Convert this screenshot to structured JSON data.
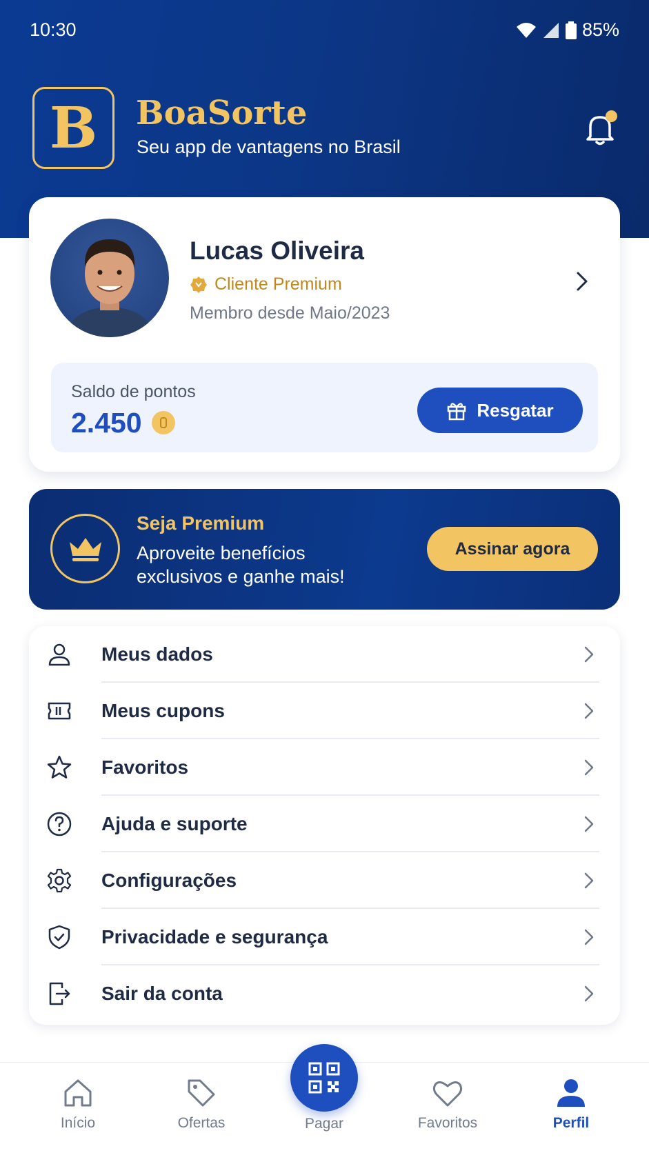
{
  "status_bar": {
    "time": "10:30",
    "battery": "85%"
  },
  "brand": {
    "logo_letter": "B",
    "name": "BoaSorte",
    "tagline": "Seu app de vantagens no Brasil"
  },
  "profile": {
    "name": "Lucas Oliveira",
    "tier": "Cliente Premium",
    "member_since": "Membro desde Maio/2023"
  },
  "points": {
    "label": "Saldo de pontos",
    "value": "2.450",
    "redeem_label": "Resgatar"
  },
  "premium_banner": {
    "title": "Seja Premium",
    "line1": "Aproveite benefícios",
    "line2": "exclusivos e ganhe mais!",
    "cta": "Assinar agora"
  },
  "menu": {
    "items": [
      {
        "label": "Meus dados",
        "icon": "user-icon"
      },
      {
        "label": "Meus cupons",
        "icon": "ticket-icon"
      },
      {
        "label": "Favoritos",
        "icon": "star-icon"
      },
      {
        "label": "Ajuda e suporte",
        "icon": "help-icon"
      },
      {
        "label": "Configurações",
        "icon": "gear-icon"
      },
      {
        "label": "Privacidade e segurança",
        "icon": "shield-icon"
      },
      {
        "label": "Sair da conta",
        "icon": "logout-icon"
      }
    ]
  },
  "bottom_nav": {
    "items": [
      {
        "label": "Início",
        "icon": "home-icon"
      },
      {
        "label": "Ofertas",
        "icon": "tag-icon"
      },
      {
        "label": "Pagar",
        "icon": "qr-code-icon"
      },
      {
        "label": "Favoritos",
        "icon": "heart-icon"
      },
      {
        "label": "Perfil",
        "icon": "person-icon",
        "active": true
      }
    ]
  },
  "colors": {
    "primary": "#1f4fbf",
    "navy": "#0c3787",
    "gold": "#f2c462",
    "premium_text": "#c2871c"
  }
}
